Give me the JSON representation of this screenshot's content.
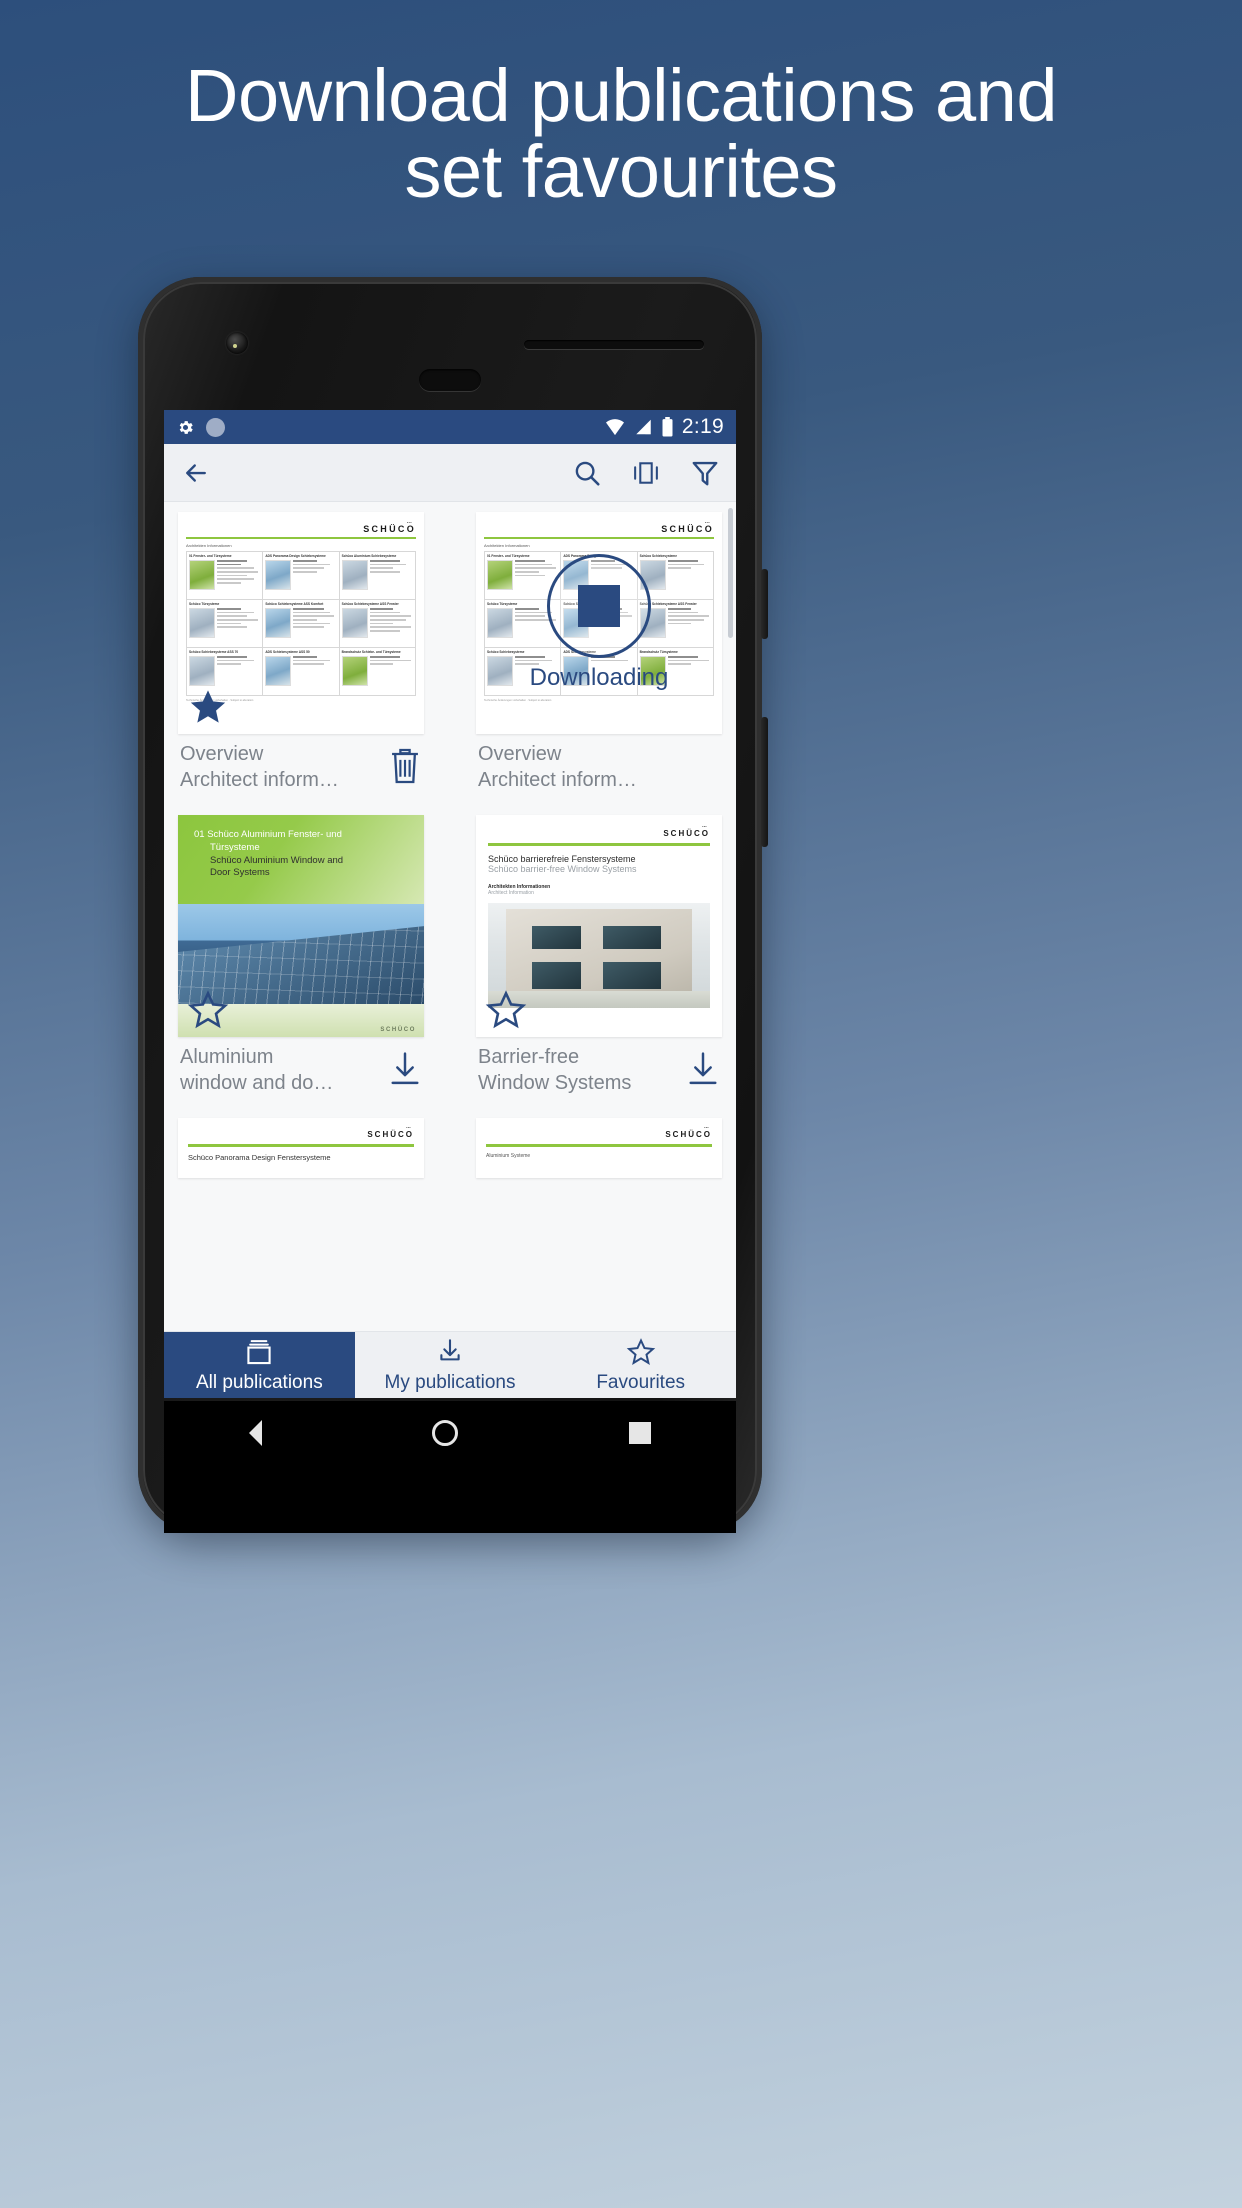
{
  "promo": {
    "line1": "Download publications and",
    "line2": "set favourites"
  },
  "colors": {
    "brand_blue": "#2a4a80",
    "accent_green": "#8ec63f",
    "caption_grey": "#7d838b",
    "bg_top": "#2d4f7c",
    "bg_bottom": "#c3d2de"
  },
  "phone": {
    "statusbar": {
      "icons_left": [
        "gear-icon",
        "circle-indicator-icon"
      ],
      "icons_right": [
        "wifi-icon",
        "signal-icon",
        "battery-icon"
      ],
      "time": "2:19"
    },
    "toolbar": {
      "back_label": "back-arrow-icon",
      "actions": [
        "search-icon",
        "view-mode-icon",
        "filter-icon"
      ]
    },
    "android_nav": [
      "back-triangle-icon",
      "home-circle-icon",
      "recents-square-icon"
    ]
  },
  "publications": [
    {
      "title_line1": "Overview",
      "title_line2": "Architect inform…",
      "thumb_type": "document-sheet",
      "thumb_logo": "SCHÜCO",
      "thumb_logo_sup": "***",
      "thumb_caption": "Architekten Informationen",
      "favourite": true,
      "favourite_state": "filled",
      "action_icon": "trash-icon",
      "downloading": false
    },
    {
      "title_line1": "Overview",
      "title_line2": "Architect inform…",
      "thumb_type": "document-sheet",
      "thumb_logo": "SCHÜCO",
      "thumb_logo_sup": "***",
      "thumb_caption": "Architekten Informationen",
      "favourite": false,
      "favourite_state": "none",
      "action_icon": "none",
      "downloading": true,
      "download_label": "Downloading"
    },
    {
      "title_line1": "Aluminium",
      "title_line2": "window and do…",
      "thumb_type": "green-cover",
      "cover_num": "01",
      "cover_de_line1": "Schüco Aluminium Fenster- und",
      "cover_de_line2": "Türsysteme",
      "cover_en_line1": "Schüco Aluminium Window and",
      "cover_en_line2": "Door Systems",
      "cover_logo": "SCHÜCO",
      "favourite": true,
      "favourite_state": "outline",
      "action_icon": "download-icon",
      "downloading": false
    },
    {
      "title_line1": "Barrier-free",
      "title_line2": "Window Systems",
      "thumb_type": "white-cover",
      "thumb_logo": "SCHÜCO",
      "thumb_logo_sup": "***",
      "cover_de_line1": "Schüco barrierefreie Fenstersysteme",
      "cover_en_line1": "Schüco barrier-free Window Systems",
      "cover_sub_de": "Architekten Informationen",
      "cover_sub_en": "Architect Information",
      "favourite": true,
      "favourite_state": "outline",
      "action_icon": "download-icon",
      "downloading": false
    }
  ],
  "peek_row": [
    {
      "logo": "SCHÜCO",
      "logo_sup": "***",
      "title": "Schüco Panorama Design Fenstersysteme"
    },
    {
      "logo": "SCHÜCO",
      "logo_sup": "***",
      "title": "Aluminium Systeme"
    }
  ],
  "bottom_nav": [
    {
      "label": "All publications",
      "icon": "publications-stack-icon",
      "active": true
    },
    {
      "label": "My publications",
      "icon": "download-icon",
      "active": false
    },
    {
      "label": "Favourites",
      "icon": "star-outline-icon",
      "active": false
    }
  ]
}
